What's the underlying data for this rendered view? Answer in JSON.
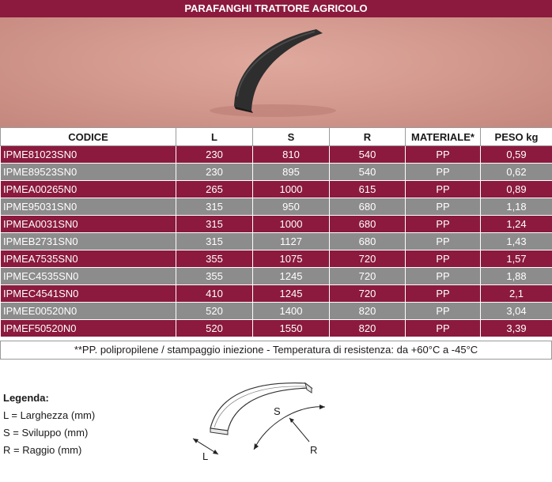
{
  "header": {
    "title": "PARAFANGHI TRATTORE AGRICOLO"
  },
  "table": {
    "columns": [
      "CODICE",
      "L",
      "S",
      "R",
      "MATERIALE*",
      "PESO kg"
    ],
    "rows": [
      [
        "IPME81023SN0",
        "230",
        "810",
        "540",
        "PP",
        "0,59"
      ],
      [
        "IPME89523SN0",
        "230",
        "895",
        "540",
        "PP",
        "0,62"
      ],
      [
        "IPMEA00265N0",
        "265",
        "1000",
        "615",
        "PP",
        "0,89"
      ],
      [
        "IPME95031SN0",
        "315",
        "950",
        "680",
        "PP",
        "1,18"
      ],
      [
        "IPMEA0031SN0",
        "315",
        "1000",
        "680",
        "PP",
        "1,24"
      ],
      [
        "IPMEB2731SN0",
        "315",
        "1127",
        "680",
        "PP",
        "1,43"
      ],
      [
        "IPMEA7535SN0",
        "355",
        "1075",
        "720",
        "PP",
        "1,57"
      ],
      [
        "IPMEC4535SN0",
        "355",
        "1245",
        "720",
        "PP",
        "1,88"
      ],
      [
        "IPMEC4541SN0",
        "410",
        "1245",
        "720",
        "PP",
        "2,1"
      ],
      [
        "IPMEE00520N0",
        "520",
        "1400",
        "820",
        "PP",
        "3,04"
      ],
      [
        "IPMEF50520N0",
        "520",
        "1550",
        "820",
        "PP",
        "3,39"
      ]
    ],
    "note": "**PP. polipropilene / stampaggio iniezione  -  Temperatura di resistenza: da +60°C a -45°C"
  },
  "legend": {
    "title": "Legenda:",
    "items": [
      "L = Larghezza (mm)",
      "S = Sviluppo (mm)",
      "R = Raggio (mm)"
    ]
  },
  "diagram": {
    "label_s": "S",
    "label_r": "R",
    "label_l": "L"
  },
  "colors": {
    "row_red": "#8b1a3e",
    "row_grey": "#8c8c8c",
    "photo_bg": "#d49a8f"
  }
}
